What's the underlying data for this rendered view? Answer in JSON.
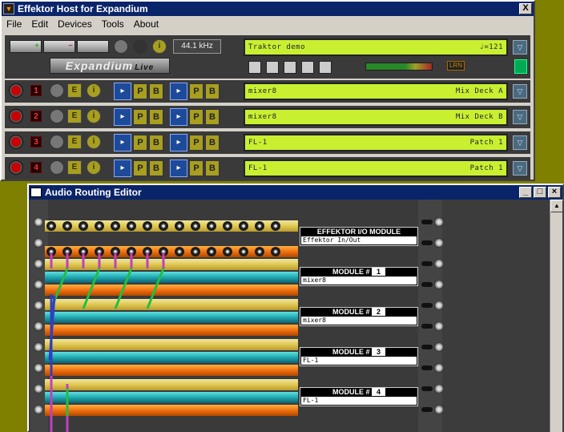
{
  "main_window": {
    "title": "Effektor Host for Expandium",
    "close": "X",
    "menu": [
      "File",
      "Edit",
      "Devices",
      "Tools",
      "About"
    ],
    "samplerate": "44.1 kHz",
    "logo": "Expandium",
    "logo_suffix": "Live",
    "project": {
      "name": "Traktor demo",
      "tempo": "♩=121"
    },
    "lrn": "LRN",
    "channels": [
      {
        "num": "1",
        "name": "mixer8",
        "patch": "Mix Deck A"
      },
      {
        "num": "2",
        "name": "mixer8",
        "patch": "Mix Deck B"
      },
      {
        "num": "3",
        "name": "FL-1",
        "patch": "Patch 1"
      },
      {
        "num": "4",
        "name": "FL-1",
        "patch": "Patch 1"
      }
    ],
    "e_label": "E",
    "p_label": "P",
    "b_label": "B",
    "dropdown": "▽"
  },
  "routing_window": {
    "title": "Audio Routing Editor",
    "io_module": {
      "title": "EFFEKTOR I/O MODULE",
      "value": "Effektor In/Out"
    },
    "modules": [
      {
        "label": "MODULE #",
        "num": "1",
        "name": "mixer8"
      },
      {
        "label": "MODULE #",
        "num": "2",
        "name": "mixer8"
      },
      {
        "label": "MODULE #",
        "num": "3",
        "name": "FL-1"
      },
      {
        "label": "MODULE #",
        "num": "4",
        "name": "FL-1"
      }
    ]
  },
  "colors": {
    "lcd": "#c8f030",
    "titlebar": "#0a246a",
    "desktop": "#808000"
  }
}
